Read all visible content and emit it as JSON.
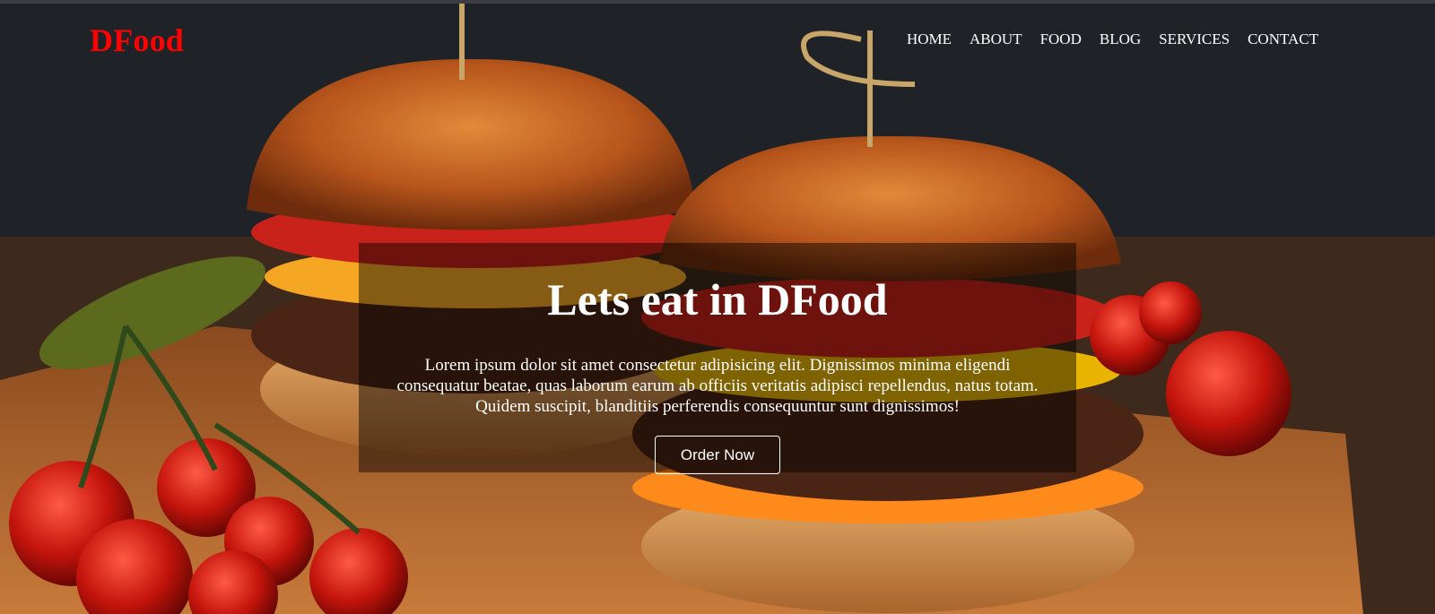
{
  "brand": {
    "logo_text": "DFood",
    "logo_color": "#ff0000"
  },
  "nav": {
    "items": [
      {
        "label": "HOME"
      },
      {
        "label": "ABOUT"
      },
      {
        "label": "FOOD"
      },
      {
        "label": "BLOG"
      },
      {
        "label": "SERVICES"
      },
      {
        "label": "CONTACT"
      }
    ]
  },
  "hero": {
    "background_image": "burger-photo",
    "title": "Lets eat in DFood",
    "description": "Lorem ipsum dolor sit amet consectetur adipisicing elit. Dignissimos minima eligendi consequatur beatae, quas laborum earum ab officiis veritatis adipisci repellendus, natus totam. Quidem suscipit, blanditiis perferendis consequuntur sunt dignissimos!",
    "cta_label": "Order Now"
  }
}
